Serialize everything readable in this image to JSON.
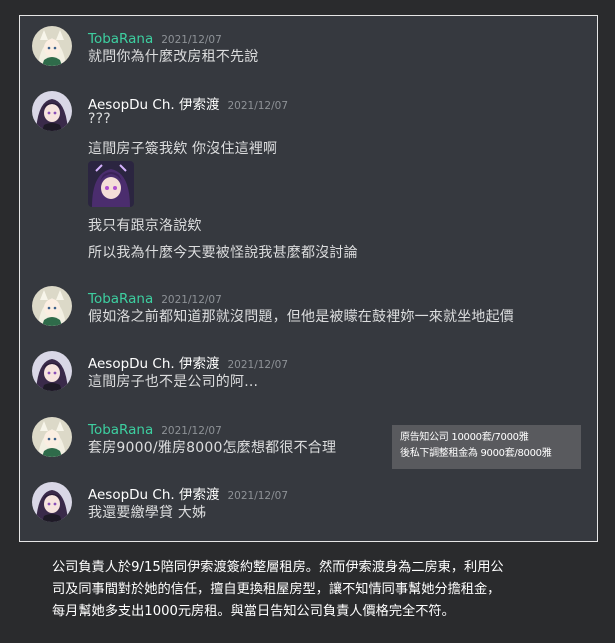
{
  "users": {
    "toba": {
      "name": "TobaRana",
      "color": "#3dcfa0"
    },
    "aesop": {
      "name": "AesopDu Ch. 伊索渡",
      "color": "#ffffff"
    }
  },
  "messages": [
    {
      "user": "toba",
      "timestamp": "2021/12/07",
      "lines": [
        "就問你為什麼改房租不先說"
      ]
    },
    {
      "user": "aesop",
      "timestamp": "2021/12/07",
      "lines": [
        "???",
        "這間房子簽我欸 你沒住這裡啊",
        "我只有跟京洛說欸",
        "所以我為什麼今天要被怪說我甚麼都沒討論"
      ],
      "has_image": true
    },
    {
      "user": "toba",
      "timestamp": "2021/12/07",
      "lines": [
        "假如洛之前都知道那就沒問題，但他是被矇在鼓裡妳一來就坐地起價"
      ]
    },
    {
      "user": "aesop",
      "timestamp": "2021/12/07",
      "lines": [
        "這間房子也不是公司的阿..."
      ]
    },
    {
      "user": "toba",
      "timestamp": "2021/12/07",
      "lines": [
        "套房9000/雅房8000怎麼想都很不合理"
      ]
    },
    {
      "user": "aesop",
      "timestamp": "2021/12/07",
      "lines": [
        "我還要繳學貸 大姊"
      ]
    }
  ],
  "note": {
    "line1": "原告知公司 10000套/7000雅",
    "line2": "後私下調整租金為 9000套/8000雅"
  },
  "caption": {
    "line1": "公司負責人於9/15陪同伊索渡簽約整層租房。然而伊索渡身為二房東，利用公",
    "line2": "司及同事間對於她的信任，擅自更換租屋房型，讓不知情同事幫她分擔租金，",
    "line3": "每月幫她多支出1000元房租。與當日告知公司負責人價格完全不符。"
  }
}
